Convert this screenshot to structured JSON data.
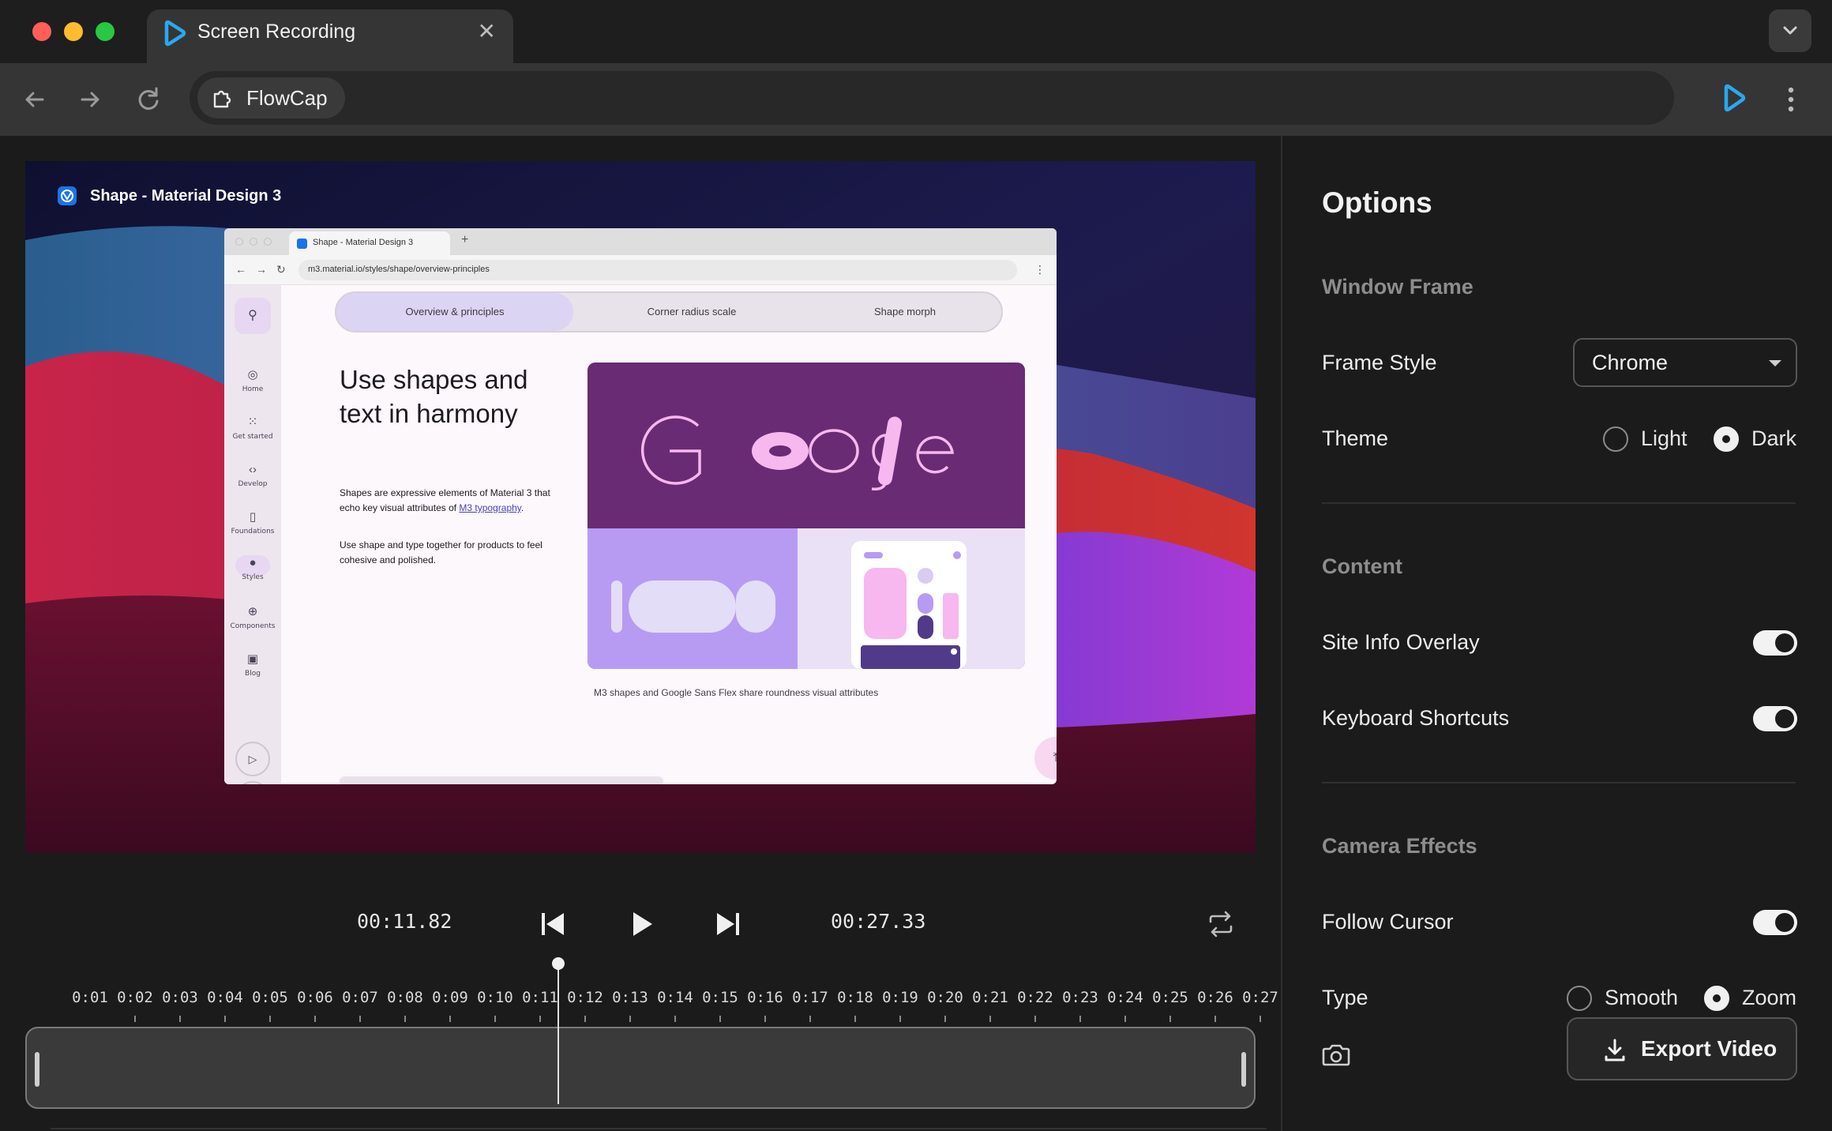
{
  "browser": {
    "tab_title": "Screen Recording",
    "tab_close": "✕",
    "site_chip_label": "FlowCap"
  },
  "preview": {
    "overlay_title": "Shape - Material Design 3",
    "inner_browser": {
      "tab_title": "Shape - Material Design 3",
      "new_tab": "+",
      "url": "m3.material.io/styles/shape/overview-principles"
    },
    "rail": {
      "items": [
        {
          "label": "Home"
        },
        {
          "label": "Get started"
        },
        {
          "label": "Develop"
        },
        {
          "label": "Foundations"
        },
        {
          "label": "Styles"
        },
        {
          "label": "Components"
        },
        {
          "label": "Blog"
        }
      ]
    },
    "tabs": [
      "Overview & principles",
      "Corner radius scale",
      "Shape morph"
    ],
    "heading": "Use shapes and text in harmony",
    "para1_prefix": "Shapes are expressive elements of Material 3 that echo key visual attributes of ",
    "para1_link": "M3 typography",
    "para1_suffix": ".",
    "para2": "Use shape and type together for products to feel cohesive and polished.",
    "caption": "M3 shapes and Google Sans Flex share roundness visual attributes"
  },
  "playback": {
    "current_time": "00:11.82",
    "total_time": "00:27.33",
    "progress_fraction": 0.4325
  },
  "timeline": {
    "ticks": [
      "0:01",
      "0:02",
      "0:03",
      "0:04",
      "0:05",
      "0:06",
      "0:07",
      "0:08",
      "0:09",
      "0:10",
      "0:11",
      "0:12",
      "0:13",
      "0:14",
      "0:15",
      "0:16",
      "0:17",
      "0:18",
      "0:19",
      "0:20",
      "0:21",
      "0:22",
      "0:23",
      "0:24",
      "0:25",
      "0:26",
      "0:27"
    ]
  },
  "options": {
    "title": "Options",
    "window_frame": {
      "section": "Window Frame",
      "frame_style_label": "Frame Style",
      "frame_style_value": "Chrome",
      "theme_label": "Theme",
      "theme_light": "Light",
      "theme_dark": "Dark",
      "theme_selected": "Dark"
    },
    "content": {
      "section": "Content",
      "site_info_overlay": "Site Info Overlay",
      "site_info_overlay_on": true,
      "keyboard_shortcuts": "Keyboard Shortcuts",
      "keyboard_shortcuts_on": true
    },
    "camera_effects": {
      "section": "Camera Effects",
      "follow_cursor": "Follow Cursor",
      "follow_cursor_on": true,
      "type_label": "Type",
      "type_smooth": "Smooth",
      "type_zoom": "Zoom",
      "type_selected": "Zoom"
    },
    "export_label": "Export Video"
  },
  "colors": {
    "accent_blue": "#2aa8f0",
    "hero_purple": "#692b73",
    "hero_lavender": "#b79bf2",
    "hero_pink": "#f7b7ef"
  }
}
